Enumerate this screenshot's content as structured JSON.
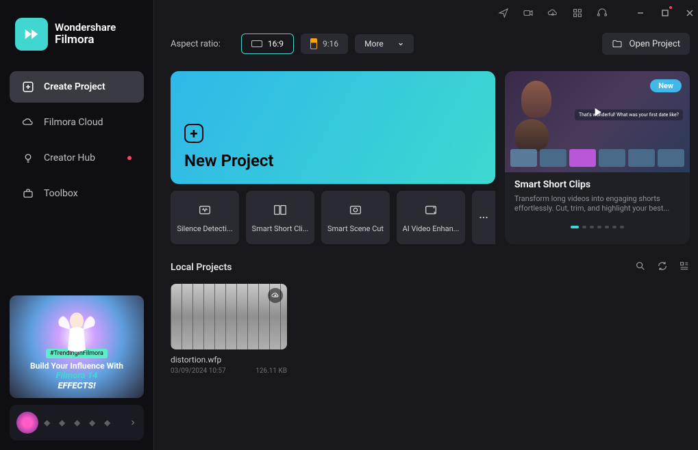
{
  "logo": {
    "brand": "Wondershare",
    "product": "Filmora"
  },
  "nav": {
    "create": "Create Project",
    "cloud": "Filmora Cloud",
    "hub": "Creator Hub",
    "toolbox": "Toolbox"
  },
  "promo": {
    "tag": "#TrendinginFilmora",
    "line1": "Build Your Influence With",
    "line2": "Filmora 14",
    "line3": "EFFECTS!"
  },
  "toolbar": {
    "aspect_label": "Aspect ratio:",
    "ratio_169": "16:9",
    "ratio_916": "9:16",
    "more": "More",
    "open": "Open Project"
  },
  "hero": {
    "new_project": "New Project",
    "tools": [
      "Silence Detecti...",
      "Smart Short Cli...",
      "Smart Scene Cut",
      "AI Video Enhan..."
    ]
  },
  "feature": {
    "badge": "New",
    "title": "Smart Short Clips",
    "desc": "Transform long videos into engaging shorts effortlessly. Cut, trim, and highlight your best...",
    "caption": "That's wonderful! What was your first date like?"
  },
  "local": {
    "title": "Local Projects",
    "project": {
      "name": "distortion.wfp",
      "date": "03/09/2024 10:57",
      "size": "126.11 KB"
    }
  }
}
